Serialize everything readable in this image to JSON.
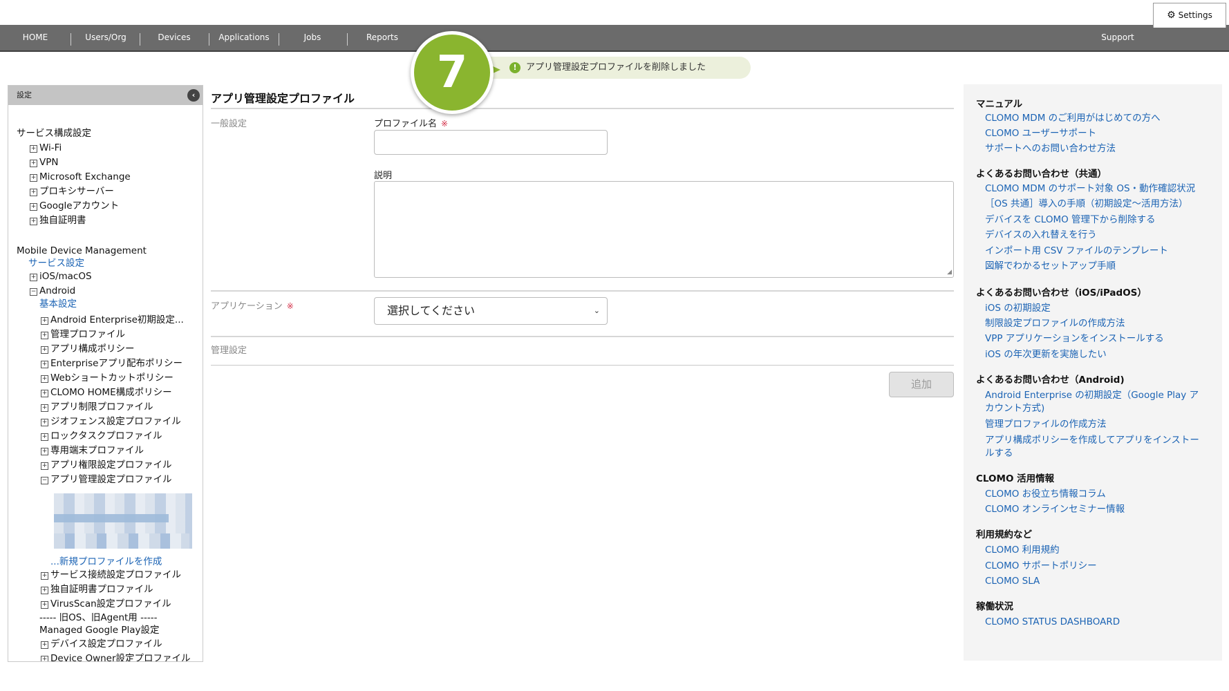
{
  "nav": {
    "items": [
      "HOME",
      "Users/Org",
      "Devices",
      "Applications",
      "Jobs",
      "Reports"
    ],
    "support": "Support",
    "settings": "Settings"
  },
  "step": {
    "number": "7"
  },
  "toast": {
    "icon": "info-icon",
    "glyph": "!",
    "message": "アプリ管理設定プロファイルを削除しました"
  },
  "sidebar": {
    "header": "設定",
    "collapse_glyph": "‹",
    "service_config": "サービス構成設定",
    "service_items": [
      "Wi-Fi",
      "VPN",
      "Microsoft Exchange",
      "プロキシサーバー",
      "Googleアカウント",
      "独自証明書"
    ],
    "mdm": "Mobile Device Management",
    "service_settings": "サービス設定",
    "ios": "iOS/macOS",
    "android": "Android",
    "basic_settings": "基本設定",
    "android_items": [
      "Android Enterprise初期設定...",
      "管理プロファイル",
      "アプリ構成ポリシー",
      "Enterpriseアプリ配布ポリシー",
      "Webショートカットポリシー",
      "CLOMO HOME構成ポリシー",
      "アプリ制限プロファイル",
      "ジオフェンス設定プロファイル",
      "ロックタスクプロファイル",
      "専用端末プロファイル",
      "アプリ権限設定プロファイル",
      "アプリ管理設定プロファイル"
    ],
    "new_profile": "...新規プロファイルを作成",
    "after_items": [
      "サービス接続設定プロファイル",
      "独自証明書プロファイル",
      "VirusScan設定プロファイル"
    ],
    "legacy": "----- 旧OS、旧Agent用 -----",
    "managed_gplay": "Managed Google Play設定",
    "legacy_items": [
      "デバイス設定プロファイル",
      "Device Owner設定プロファイル"
    ]
  },
  "main": {
    "title": "アプリ管理設定プロファイル",
    "general": "一般設定",
    "profile_name_label": "プロファイル名",
    "required_mark": "※",
    "description_label": "説明",
    "application_label": "アプリケーション",
    "application_select": "選択してください",
    "management": "管理設定",
    "add_button": "追加"
  },
  "right_panel": {
    "sections": [
      {
        "heading": "マニュアル",
        "links": [
          "CLOMO MDM のご利用がはじめての方へ",
          "CLOMO ユーザーサポート",
          "サポートへのお問い合わせ方法"
        ]
      },
      {
        "heading": "よくあるお問い合わせ（共通）",
        "links": [
          "CLOMO MDM のサポート対象 OS・動作確認状況",
          "［OS 共通］導入の手順（初期設定～活用方法）",
          "デバイスを CLOMO 管理下から削除する",
          "デバイスの入れ替えを行う",
          "インポート用 CSV ファイルのテンプレート",
          "図解でわかるセットアップ手順"
        ]
      },
      {
        "heading": "よくあるお問い合わせ（iOS/iPadOS）",
        "links": [
          "iOS の初期設定",
          "制限設定プロファイルの作成方法",
          "VPP アプリケーションをインストールする",
          "iOS の年次更新を実施したい"
        ]
      },
      {
        "heading": "よくあるお問い合わせ（Android)",
        "links": [
          "Android Enterprise の初期設定（Google Play ア",
          "カウント方式)",
          "管理プロファイルの作成方法",
          "アプリ構成ポリシーを作成してアプリをインストー",
          "ルする"
        ]
      },
      {
        "heading": "CLOMO 活用情報",
        "links": [
          "CLOMO お役立ち情報コラム",
          "CLOMO オンラインセミナー情報"
        ]
      },
      {
        "heading": "利用規約など",
        "links": [
          "CLOMO 利用規約",
          "CLOMO サポートポリシー",
          "CLOMO SLA"
        ]
      },
      {
        "heading": "稼働状況",
        "links": [
          "CLOMO STATUS DASHBOARD"
        ]
      }
    ]
  }
}
